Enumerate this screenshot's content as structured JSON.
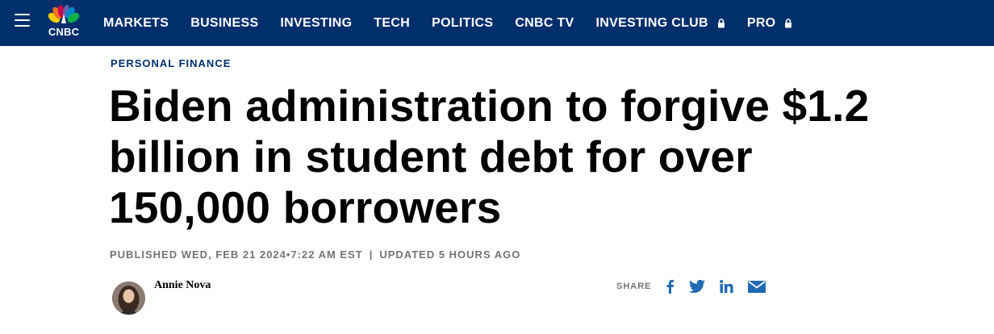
{
  "nav": {
    "logo_text": "CNBC",
    "items": [
      {
        "label": "MARKETS",
        "locked": false
      },
      {
        "label": "BUSINESS",
        "locked": false
      },
      {
        "label": "INVESTING",
        "locked": false
      },
      {
        "label": "TECH",
        "locked": false
      },
      {
        "label": "POLITICS",
        "locked": false
      },
      {
        "label": "CNBC TV",
        "locked": false
      },
      {
        "label": "INVESTING CLUB",
        "locked": true
      },
      {
        "label": "PRO",
        "locked": true
      }
    ],
    "background_color": "#002f6c",
    "menu_icon": "hamburger-menu-icon",
    "lock_icon": "lock-icon"
  },
  "article": {
    "category": "PERSONAL FINANCE",
    "headline_lines": [
      "Biden administration to forgive $1.2",
      "billion in student debt for over",
      "150,000 borrowers"
    ],
    "published": "PUBLISHED WED, FEB 21 2024•7:22 AM EST",
    "separator": "|",
    "updated": "UPDATED 5 HOURS AGO",
    "author": "Annie Nova"
  },
  "share": {
    "label": "SHARE",
    "icons": [
      "facebook-icon",
      "twitter-icon",
      "linkedin-icon",
      "email-icon"
    ],
    "icon_color": "#1f6bb3"
  }
}
